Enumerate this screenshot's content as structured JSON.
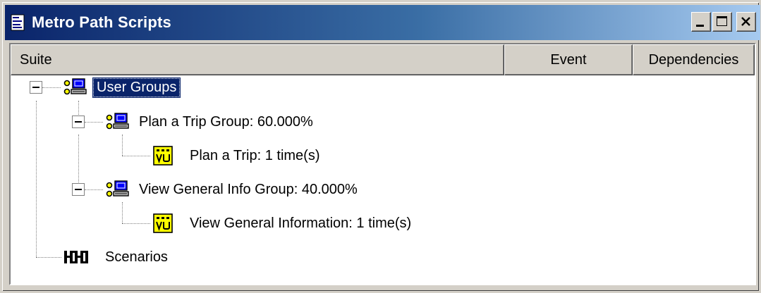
{
  "window": {
    "title": "Metro Path Scripts",
    "controls": {
      "minimize": "_",
      "maximize": "□",
      "close": "×"
    },
    "colors": {
      "titlebar_start": "#0a246a",
      "titlebar_end": "#a6caf0",
      "selection": "#0a246a"
    }
  },
  "columns": {
    "suite": "Suite",
    "event": "Event",
    "dependencies": "Dependencies"
  },
  "tree": {
    "root": {
      "label": "User Groups",
      "icon": "user-group-icon",
      "selected": true
    },
    "groups": [
      {
        "label": "Plan a Trip Group: 60.000%",
        "icon": "user-group-icon",
        "child": {
          "label": "Plan a Trip: 1 time(s)",
          "icon": "vu-script-icon"
        }
      },
      {
        "label": "View General Info Group: 40.000%",
        "icon": "user-group-icon",
        "child": {
          "label": "View General Information: 1 time(s)",
          "icon": "vu-script-icon"
        }
      }
    ],
    "scenarios": {
      "label": "Scenarios",
      "icon": "scenarios-icon"
    }
  }
}
